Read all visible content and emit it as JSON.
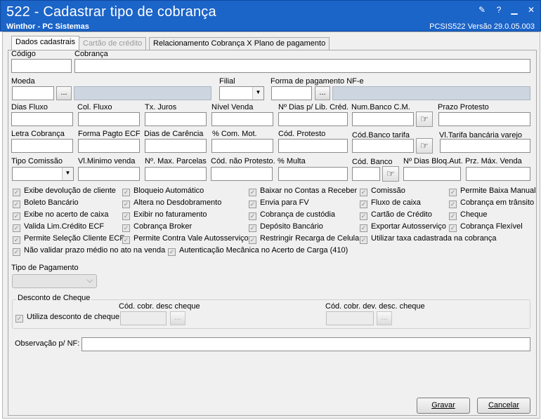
{
  "window": {
    "title": "522 - Cadastrar tipo de cobrança",
    "subtitle": "Winthor - PC Sistemas",
    "version": "PCSIS522  Versão  29.0.05.003"
  },
  "tabs": [
    {
      "label": "Dados cadastrais"
    },
    {
      "label": "Cartão de crédito"
    },
    {
      "label": "Relacionamento Cobrança X Plano de pagamento"
    }
  ],
  "fields": {
    "codigo": "Código",
    "cobranca": "Cobrança",
    "moeda": "Moeda",
    "filial": "Filial",
    "forma_pagamento_nfe": "Forma de pagamento NF-e",
    "dias_fluxo": "Dias Fluxo",
    "col_fluxo": "Col. Fluxo",
    "tx_juros": "Tx. Juros",
    "nivel_venda": "Nível Venda",
    "n_dias_lib_cred": "Nº Dias p/ Lib. Créd.",
    "num_banco_cm": "Num.Banco C.M.",
    "prazo_protesto": "Prazo Protesto",
    "letra_cobranca": "Letra Cobrança",
    "forma_pagto_ecf": "Forma Pagto ECF",
    "dias_carencia": "Dias de Carência",
    "com_mot": "% Com. Mot.",
    "cod_protesto": "Cód. Protesto",
    "cod_banco_tarifa": "Cód.Banco tarifa",
    "vl_tarifa": "Vl.Tarifa bancária varejo",
    "tipo_comissao": "Tipo Comissão",
    "vl_minimo_venda": "Vl.Minimo venda",
    "n_max_parcelas": "Nº. Max. Parcelas",
    "cod_nao_protesto": "Cód. não Protesto.",
    "multa": "% Multa",
    "cod_banco": "Cód. Banco",
    "n_dias_bloq": "Nº Dias Bloq.Aut.",
    "prz_max_venda": "Prz. Máx. Venda"
  },
  "checkboxes": {
    "c1": [
      "Exibe devolução de cliente",
      "Boleto Bancário",
      "Exibe no acerto de caixa",
      "Valida Lim.Crédito ECF",
      "Permite Seleção Cliente ECF"
    ],
    "c2": [
      "Bloqueio Automático",
      "Altera no Desdobramento",
      "Exibir no faturamento",
      "Cobrança Broker",
      "Permite Contra Vale Autosserviço"
    ],
    "c3": [
      "Baixar no Contas a Receber",
      "Envia para FV",
      "Cobrança de custódia",
      "Depósito Bancário",
      "Restringir Recarga de Celular"
    ],
    "c4": [
      "Comissão",
      "Fluxo de caixa",
      "Cartão de Crédito",
      "Exportar Autosserviço",
      "Utilizar taxa cadastrada na cobrança"
    ],
    "c5": [
      "Permite Baixa Manual",
      "Cobrança em trânsito",
      "Cheque",
      "Cobrança Flexível"
    ],
    "extra1": "Não validar prazo médio no ato na venda",
    "extra2": "Autenticação Mecânica no Acerto de Carga (410)"
  },
  "tipo_pagamento": {
    "label": "Tipo de Pagamento"
  },
  "desconto_cheque": {
    "title": "Desconto de Cheque",
    "utiliza": "Utiliza desconto de cheque",
    "cod_desc": "Cód. cobr. desc cheque",
    "cod_dev_desc": "Cód. cobr. dev. desc. cheque"
  },
  "observacao": {
    "label": "Observação p/ NF:"
  },
  "buttons": {
    "ellipsis": "...",
    "gravar": "Gravar",
    "cancelar": "Cancelar"
  }
}
